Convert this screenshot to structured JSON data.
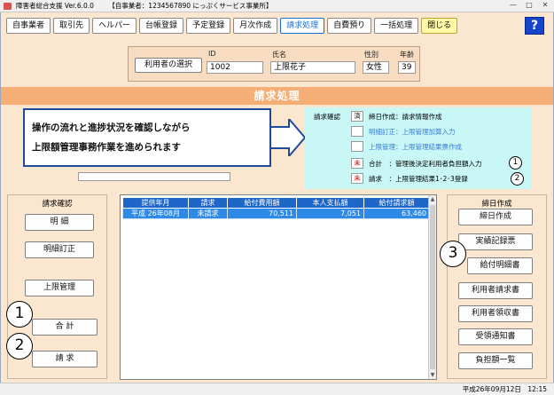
{
  "window": {
    "title": "障害者総合支援 Ver.6.0.0",
    "business": "【自事業者：1234567890 にっぷくサービス事業所】",
    "controls": {
      "minimize": "—",
      "maximize": "□",
      "close": "✕"
    }
  },
  "toolbar": {
    "items": [
      "自事業者",
      "取引先",
      "ヘルパー",
      "台帳登録",
      "予定登録",
      "月次作成",
      "請求処理",
      "自費預り",
      "一括処理",
      "閉じる"
    ],
    "active": "請求処理",
    "help_label": "?"
  },
  "user": {
    "select_button": "利用者の選択",
    "id_label": "ID",
    "id_value": "1002",
    "name_label": "氏名",
    "name_value": "上限花子",
    "gender_label": "性別",
    "gender_value": "女性",
    "age_label": "年齢",
    "age_value": "39"
  },
  "section_title": "請求処理",
  "callout": {
    "line1": "操作の流れと進捗状況を確認しながら",
    "line2": "上限額管理事務作業を進められます"
  },
  "status": {
    "label": "請求確認",
    "rows": [
      {
        "mark": "済",
        "text": "締日作成：請求情報作成",
        "tone": "normal"
      },
      {
        "mark": "",
        "text": "明細訂正：上限管理加算入力",
        "tone": "blue"
      },
      {
        "mark": "",
        "text": "上限管理：上限管理結果票作成",
        "tone": "blue"
      },
      {
        "mark": "未",
        "text": "合計　：管理後決定利用者負担額入力",
        "tone": "normal"
      },
      {
        "mark": "未",
        "text": "請求　：上限管理結果1･2･3登録",
        "tone": "normal"
      }
    ],
    "markers": [
      "1",
      "2"
    ]
  },
  "left_panel": {
    "title": "請求確認",
    "buttons": [
      "明 細",
      "明細訂正",
      "上限管理",
      "合 計",
      "請 求"
    ],
    "markers": [
      "1",
      "2"
    ]
  },
  "table": {
    "headers": [
      "提供年月",
      "請求",
      "給付費用額",
      "本人支払額",
      "給付請求額"
    ],
    "rows": [
      {
        "month": "平成 26年08月",
        "status": "未請求",
        "benefit_cost": "70,511",
        "self_pay": "7,051",
        "claim": "63,460"
      }
    ]
  },
  "right_panel": {
    "title": "締日作成",
    "buttons": [
      "締日作成",
      "実績記録票",
      "給付明細書",
      "利用者請求書",
      "利用者領収書",
      "受領通知書",
      "負担額一覧"
    ],
    "marker": "3"
  },
  "statusbar": {
    "datetime": "平成26年09月12日　12:15"
  },
  "colors": {
    "background": "#fbe6cf",
    "section_header": "#f4ae76",
    "status_panel": "#c8f7f6",
    "table_header": "#1e66c8",
    "selected_row": "#2e8ae6",
    "help": "#1544cc"
  }
}
